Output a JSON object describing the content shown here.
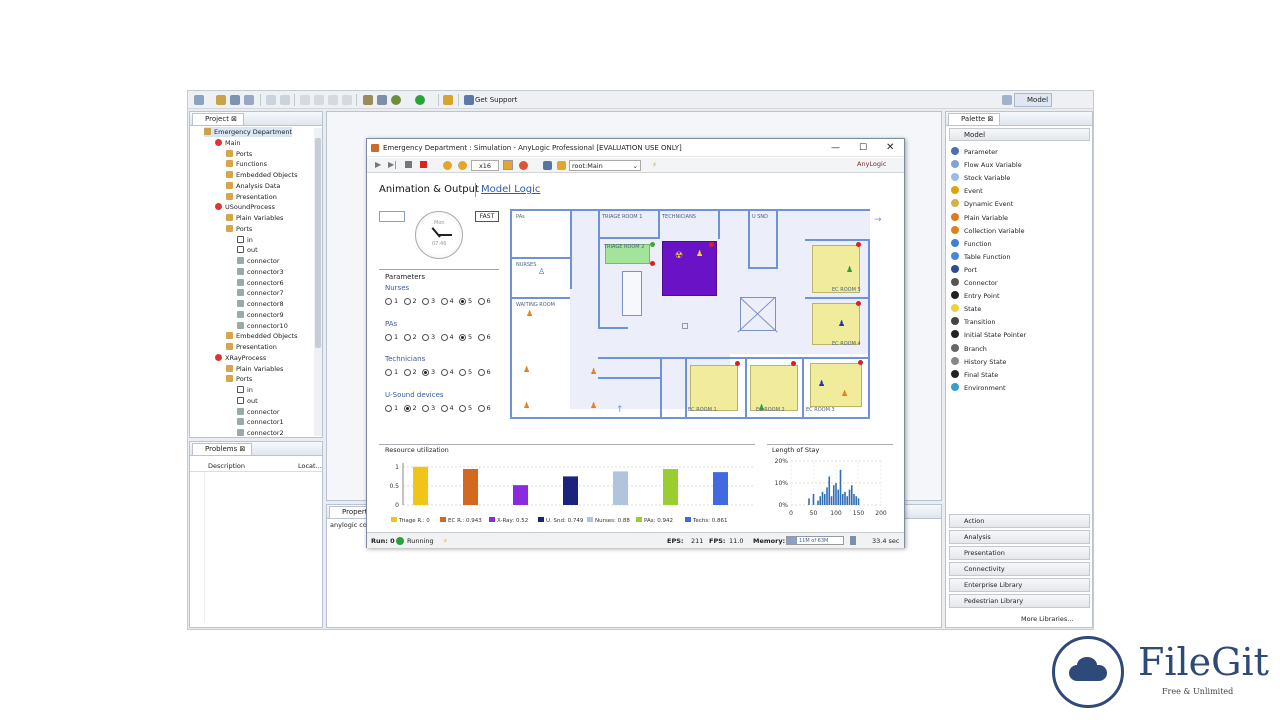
{
  "ide": {
    "toolbar": {
      "get_support": "Get Support",
      "model_label": "Model"
    },
    "project": {
      "tab": "Project",
      "tree": [
        {
          "label": "Emergency Department",
          "depth": 0,
          "icon": "project-icon"
        },
        {
          "label": "Main",
          "depth": 1,
          "icon": "agent-icon"
        },
        {
          "label": "Ports",
          "depth": 2,
          "icon": "folder-icon"
        },
        {
          "label": "Functions",
          "depth": 2,
          "icon": "folder-icon"
        },
        {
          "label": "Embedded Objects",
          "depth": 2,
          "icon": "folder-icon"
        },
        {
          "label": "Analysis Data",
          "depth": 2,
          "icon": "folder-icon"
        },
        {
          "label": "Presentation",
          "depth": 2,
          "icon": "folder-icon"
        },
        {
          "label": "USoundProcess",
          "depth": 1,
          "icon": "agent-icon"
        },
        {
          "label": "Plain Variables",
          "depth": 2,
          "icon": "folder-icon"
        },
        {
          "label": "Ports",
          "depth": 2,
          "icon": "folder-icon"
        },
        {
          "label": "in",
          "depth": 3,
          "icon": "port-icon"
        },
        {
          "label": "out",
          "depth": 3,
          "icon": "port-icon"
        },
        {
          "label": "connector",
          "depth": 3,
          "icon": "connector-icon"
        },
        {
          "label": "connector3",
          "depth": 3,
          "icon": "connector-icon"
        },
        {
          "label": "connector6",
          "depth": 3,
          "icon": "connector-icon"
        },
        {
          "label": "connector7",
          "depth": 3,
          "icon": "connector-icon"
        },
        {
          "label": "connector8",
          "depth": 3,
          "icon": "connector-icon"
        },
        {
          "label": "connector9",
          "depth": 3,
          "icon": "connector-icon"
        },
        {
          "label": "connector10",
          "depth": 3,
          "icon": "connector-icon"
        },
        {
          "label": "Embedded Objects",
          "depth": 2,
          "icon": "folder-icon"
        },
        {
          "label": "Presentation",
          "depth": 2,
          "icon": "folder-icon"
        },
        {
          "label": "XRayProcess",
          "depth": 1,
          "icon": "agent-icon"
        },
        {
          "label": "Plain Variables",
          "depth": 2,
          "icon": "folder-icon"
        },
        {
          "label": "Ports",
          "depth": 2,
          "icon": "folder-icon"
        },
        {
          "label": "in",
          "depth": 3,
          "icon": "port-icon"
        },
        {
          "label": "out",
          "depth": 3,
          "icon": "port-icon"
        },
        {
          "label": "connector",
          "depth": 3,
          "icon": "connector-icon"
        },
        {
          "label": "connector1",
          "depth": 3,
          "icon": "connector-icon"
        },
        {
          "label": "connector2",
          "depth": 3,
          "icon": "connector-icon"
        }
      ]
    },
    "problems": {
      "tab": "Problems",
      "col_description": "Description",
      "col_location": "Locat..."
    },
    "properties": {
      "tab": "Properties",
      "content": "anylogic con"
    },
    "palette": {
      "tab": "Palette",
      "section": "Model",
      "items": [
        {
          "label": "Parameter",
          "color": "#4a6fb5"
        },
        {
          "label": "Flow Aux Variable",
          "color": "#7fa3d6"
        },
        {
          "label": "Stock Variable",
          "color": "#9bbbe3"
        },
        {
          "label": "Event",
          "color": "#e0a400"
        },
        {
          "label": "Dynamic Event",
          "color": "#d2b34a"
        },
        {
          "label": "Plain Variable",
          "color": "#e07b1a"
        },
        {
          "label": "Collection Variable",
          "color": "#e0821a"
        },
        {
          "label": "Function",
          "color": "#3f7fd1"
        },
        {
          "label": "Table Function",
          "color": "#4d86d6"
        },
        {
          "label": "Port",
          "color": "#2d4f8f"
        },
        {
          "label": "Connector",
          "color": "#555555"
        },
        {
          "label": "Entry Point",
          "color": "#222222"
        },
        {
          "label": "State",
          "color": "#f0d040"
        },
        {
          "label": "Transition",
          "color": "#444444"
        },
        {
          "label": "Initial State Pointer",
          "color": "#222222"
        },
        {
          "label": "Branch",
          "color": "#666666"
        },
        {
          "label": "History State",
          "color": "#888888"
        },
        {
          "label": "Final State",
          "color": "#222222"
        },
        {
          "label": "Environment",
          "color": "#3aa0c8"
        }
      ],
      "sections": [
        "Action",
        "Analysis",
        "Presentation",
        "Connectivity",
        "Enterprise Library",
        "Pedestrian Library"
      ],
      "more": "More Libraries..."
    }
  },
  "sim": {
    "title": "Emergency Department : Simulation - AnyLogic Professional [EVALUATION USE ONLY]",
    "speed": "x16",
    "root": "root:Main",
    "brand": "AnyLogic",
    "tab_active": "Animation & Output",
    "tab_other": "Model Logic",
    "clock_label": "Mon",
    "clock_time": "07:46",
    "fast": "FAST",
    "params_title": "Parameters",
    "groups": [
      {
        "label": "Nurses",
        "selected": 5
      },
      {
        "label": "PAs",
        "selected": 5
      },
      {
        "label": "Technicians",
        "selected": 3
      },
      {
        "label": "U-Sound devices",
        "selected": 2
      }
    ],
    "options": [
      "1",
      "2",
      "3",
      "4",
      "5",
      "6"
    ],
    "rooms": {
      "pas": "PAs",
      "triage1": "TRIAGE ROOM 1",
      "technicians": "TECHNICIANS",
      "usnd": "U SND",
      "triage2": "TRIAGE ROOM 2",
      "nurses": "NURSES",
      "waiting": "WAITING ROOM",
      "ec5": "EC ROOM 5",
      "ec4": "EC ROOM 4",
      "ec1": "EC ROOM 1",
      "ec2": "EC ROOM 2",
      "ec3": "EC ROOM 3"
    },
    "status": {
      "run": "Run: 0",
      "state": "Running",
      "eps_label": "EPS:",
      "eps": "211",
      "fps_label": "FPS:",
      "fps": "11.0",
      "memory_label": "Memory:",
      "memory": "11M of 63M",
      "time": "33.4 sec"
    }
  },
  "chart_data": [
    {
      "type": "bar",
      "title": "Resource utilization",
      "categories": [
        "Triage R.: 0",
        "EC R.: 0.943",
        "X-Ray: 0.52",
        "U. Snd: 0.749",
        "Nurses: 0.88",
        "PAs: 0.942",
        "Techs: 0.861"
      ],
      "values": [
        1.0,
        0.943,
        0.52,
        0.749,
        0.88,
        0.942,
        0.861
      ],
      "colors": [
        "#f0c419",
        "#d2691e",
        "#8a2be2",
        "#1a237e",
        "#b0c4de",
        "#9acd32",
        "#4169e1"
      ],
      "yticks": [
        "0",
        "0.5",
        "1"
      ],
      "ylim": [
        0,
        1.1
      ]
    },
    {
      "type": "bar",
      "title": "Length of Stay",
      "x": [
        40,
        50,
        60,
        65,
        70,
        75,
        80,
        85,
        90,
        95,
        100,
        105,
        110,
        115,
        120,
        125,
        130,
        135,
        140,
        145,
        150
      ],
      "values": [
        0.03,
        0.05,
        0.02,
        0.04,
        0.06,
        0.05,
        0.08,
        0.13,
        0.04,
        0.09,
        0.1,
        0.07,
        0.16,
        0.05,
        0.06,
        0.04,
        0.07,
        0.09,
        0.05,
        0.04,
        0.03
      ],
      "yticks": [
        "20%",
        "10%",
        "0%"
      ],
      "xticks": [
        "0",
        "50",
        "100",
        "150",
        "200"
      ],
      "xlim": [
        0,
        200
      ],
      "ylim": [
        0,
        0.2
      ]
    }
  ],
  "watermark": {
    "brand": "FileGit",
    "tagline": "Free & Unlimited"
  }
}
